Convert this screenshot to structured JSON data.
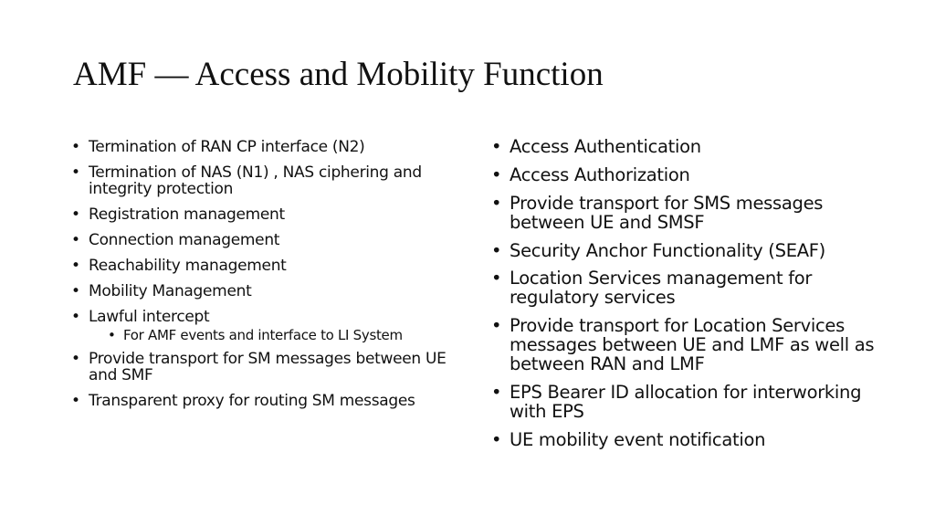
{
  "slide": {
    "title": "AMF — Access and Mobility Function",
    "bullet_glyph": "•",
    "left_column": [
      {
        "text": "Termination of RAN CP interface (N2)",
        "level": 1
      },
      {
        "text": "Termination of NAS (N1) , NAS ciphering and integrity protection",
        "level": 1
      },
      {
        "text": "Registration management",
        "level": 1
      },
      {
        "text": "Connection management",
        "level": 1
      },
      {
        "text": "Reachability management",
        "level": 1
      },
      {
        "text": "Mobility Management",
        "level": 1
      },
      {
        "text": "Lawful intercept",
        "level": 1
      },
      {
        "text": "For AMF events and interface to LI System",
        "level": 2
      },
      {
        "text": "Provide transport for SM messages between UE and SMF",
        "level": 1
      },
      {
        "text": "Transparent proxy for routing SM messages",
        "level": 1
      }
    ],
    "right_column": [
      {
        "text": "Access Authentication",
        "level": 1
      },
      {
        "text": "Access Authorization",
        "level": 1
      },
      {
        "text": "Provide transport for SMS messages between UE and SMSF",
        "level": 1
      },
      {
        "text": "Security Anchor Functionality (SEAF)",
        "level": 1
      },
      {
        "text": "Location Services management for regulatory services",
        "level": 1
      },
      {
        "text": "Provide transport for Location Services messages between UE and LMF as well as between RAN and LMF",
        "level": 1
      },
      {
        "text": "EPS Bearer ID allocation for interworking with EPS",
        "level": 1
      },
      {
        "text": "UE mobility event notification",
        "level": 1
      }
    ]
  }
}
